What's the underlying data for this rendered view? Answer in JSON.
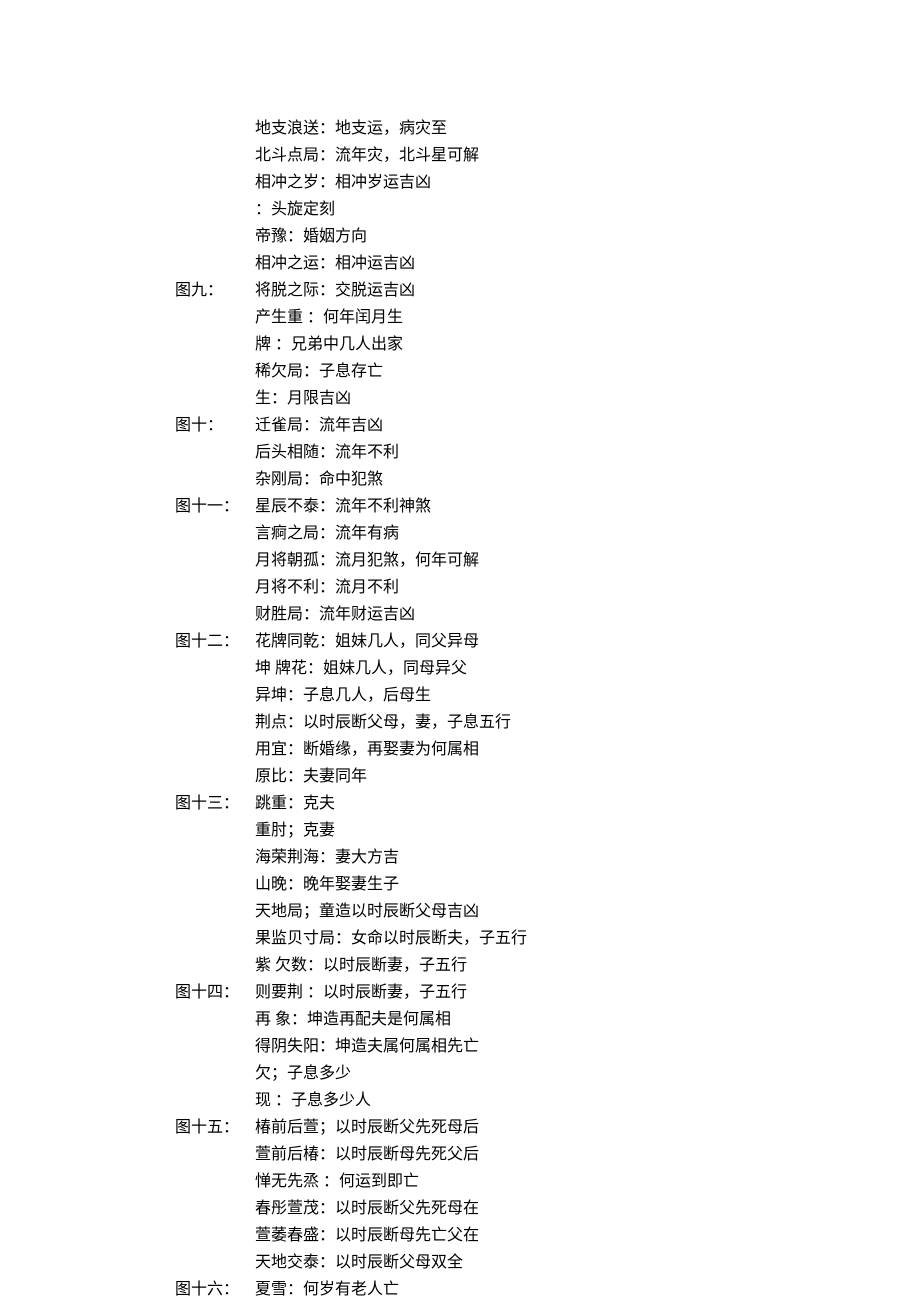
{
  "rows": [
    {
      "label": "",
      "text": "地支浪送：地支运，病灾至"
    },
    {
      "label": "",
      "text": "北斗点局：流年灾，北斗星可解"
    },
    {
      "label": "",
      "text": "相冲之岁：相冲岁运吉凶"
    },
    {
      "label": "",
      "text": "：头旋定刻"
    },
    {
      "label": "",
      "text": "帝豫：婚姻方向"
    },
    {
      "label": "",
      "text": "相冲之运：相冲运吉凶"
    },
    {
      "label": "图九：",
      "text": "将脱之际：交脱运吉凶"
    },
    {
      "label": "",
      "text": "产生重 ：何年闰月生"
    },
    {
      "label": "",
      "text": "牌 ：兄弟中几人出家"
    },
    {
      "label": "",
      "text": "稀欠局：子息存亡"
    },
    {
      "label": "",
      "text": "生：月限吉凶"
    },
    {
      "label": "图十：",
      "text": "迁雀局：流年吉凶"
    },
    {
      "label": "",
      "text": "后头相随：流年不利"
    },
    {
      "label": "",
      "text": "杂刚局：命中犯煞"
    },
    {
      "label": "图十一：",
      "text": "星辰不泰：流年不利神煞"
    },
    {
      "label": "",
      "text": "言痾之局：流年有病"
    },
    {
      "label": "",
      "text": "月将朝孤：流月犯煞，何年可解"
    },
    {
      "label": "",
      "text": "月将不利：流月不利"
    },
    {
      "label": "",
      "text": "财胜局：流年财运吉凶"
    },
    {
      "label": "图十二：",
      "text": "花牌同乾：姐妹几人，同父异母"
    },
    {
      "label": "",
      "text": "坤 牌花：姐妹几人，同母异父"
    },
    {
      "label": "",
      "text": "异坤：子息几人，后母生"
    },
    {
      "label": "",
      "text": "荆点：以时辰断父母，妻，子息五行"
    },
    {
      "label": "",
      "text": "用宜：断婚缘，再娶妻为何属相"
    },
    {
      "label": "",
      "text": "原比：夫妻同年"
    },
    {
      "label": "图十三：",
      "text": "跳重：克夫"
    },
    {
      "label": "",
      "text": "重肘；克妻"
    },
    {
      "label": "",
      "text": "海荣荆海：妻大方吉"
    },
    {
      "label": "",
      "text": "山晚：晚年娶妻生子"
    },
    {
      "label": "",
      "text": "天地局；童造以时辰断父母吉凶"
    },
    {
      "label": "",
      "text": "果监贝寸局：女命以时辰断夫，子五行"
    },
    {
      "label": "",
      "text": "紫 欠数：以时辰断妻，子五行"
    },
    {
      "label": "图十四：",
      "text": "则要荆 ：以时辰断妻，子五行"
    },
    {
      "label": "",
      "text": "再 象：坤造再配夫是何属相"
    },
    {
      "label": "",
      "text": "得阴失阳：坤造夫属何属相先亡"
    },
    {
      "label": "",
      "text": "欠；子息多少"
    },
    {
      "label": "",
      "text": "现 ：子息多少人"
    },
    {
      "label": "图十五：",
      "text": "椿前后萱；以时辰断父先死母后"
    },
    {
      "label": "",
      "text": "萱前后椿：以时辰断母先死父后"
    },
    {
      "label": "",
      "text": "惮无先烝 ：何运到即亡"
    },
    {
      "label": "",
      "text": "春彤萱茂：以时辰断父先死母在"
    },
    {
      "label": "",
      "text": "萱萎春盛：以时辰断母先亡父在"
    },
    {
      "label": "",
      "text": "天地交泰：以时辰断父母双全"
    },
    {
      "label": "图十六：",
      "text": "夏雪：何岁有老人亡"
    }
  ]
}
